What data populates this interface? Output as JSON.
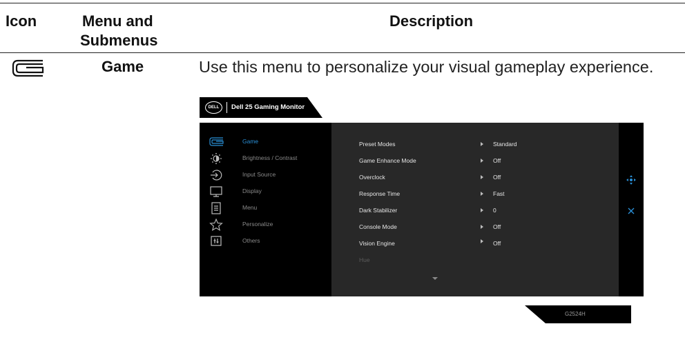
{
  "table": {
    "headers": {
      "icon": "Icon",
      "menu_line1": "Menu and",
      "menu_line2": "Submenus",
      "description": "Description"
    },
    "row": {
      "icon": "game-icon",
      "name": "Game",
      "description": "Use this menu to personalize your visual gameplay experience."
    }
  },
  "osd": {
    "brand": "DELL",
    "title": "Dell 25 Gaming Monitor",
    "menu": [
      {
        "label": "Game",
        "icon": "game-icon",
        "active": true
      },
      {
        "label": "Brightness / Contrast",
        "icon": "brightness-icon",
        "active": false
      },
      {
        "label": "Input Source",
        "icon": "input-source-icon",
        "active": false
      },
      {
        "label": "Display",
        "icon": "display-icon",
        "active": false
      },
      {
        "label": "Menu",
        "icon": "menu-icon",
        "active": false
      },
      {
        "label": "Personalize",
        "icon": "star-icon",
        "active": false
      },
      {
        "label": "Others",
        "icon": "others-icon",
        "active": false
      }
    ],
    "options": [
      {
        "name": "Preset Modes",
        "value": "Standard"
      },
      {
        "name": "Game Enhance Mode",
        "value": "Off"
      },
      {
        "name": "Overclock",
        "value": "Off"
      },
      {
        "name": "Response Time",
        "value": "Fast"
      },
      {
        "name": "Dark Stabilizer",
        "value": "0"
      },
      {
        "name": "Console Mode",
        "value": "Off"
      },
      {
        "name": "Vision Engine",
        "value": "Off"
      },
      {
        "name": "Hue",
        "value": ""
      }
    ],
    "right_icons": [
      "joystick-icon",
      "close-icon"
    ],
    "model": "G2524H",
    "colors": {
      "accent": "#2a8fd6",
      "panel_left": "#000000",
      "panel_mid": "#282828"
    }
  }
}
